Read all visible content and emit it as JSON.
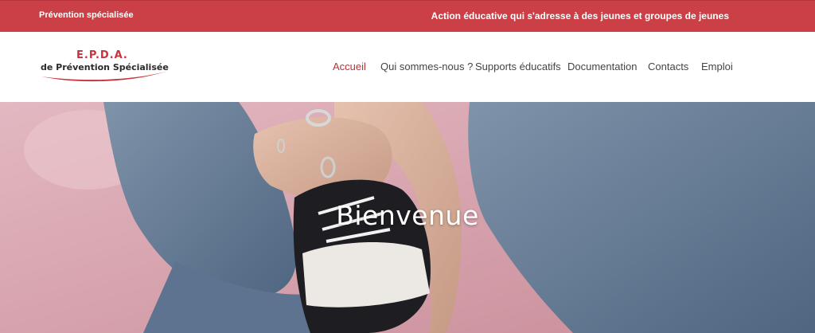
{
  "topbar": {
    "left_text": "Prévention spécialisée",
    "right_text": "Action éducative qui s'adresse à des jeunes et groupes de jeunes"
  },
  "logo": {
    "abbr": "E.P.D.A.",
    "full": "de Prévention Spécialisée"
  },
  "nav": {
    "items": [
      "Accueil",
      "Qui sommes-nous ?",
      "Supports éducatifs",
      "Documentation",
      "Contacts",
      "Emploi"
    ],
    "active": "Accueil"
  },
  "hero": {
    "title": "Bienvenue"
  },
  "colors": {
    "brand_red": "#cb3f47",
    "nav_active": "#b9323a",
    "nav_text": "#444444"
  }
}
